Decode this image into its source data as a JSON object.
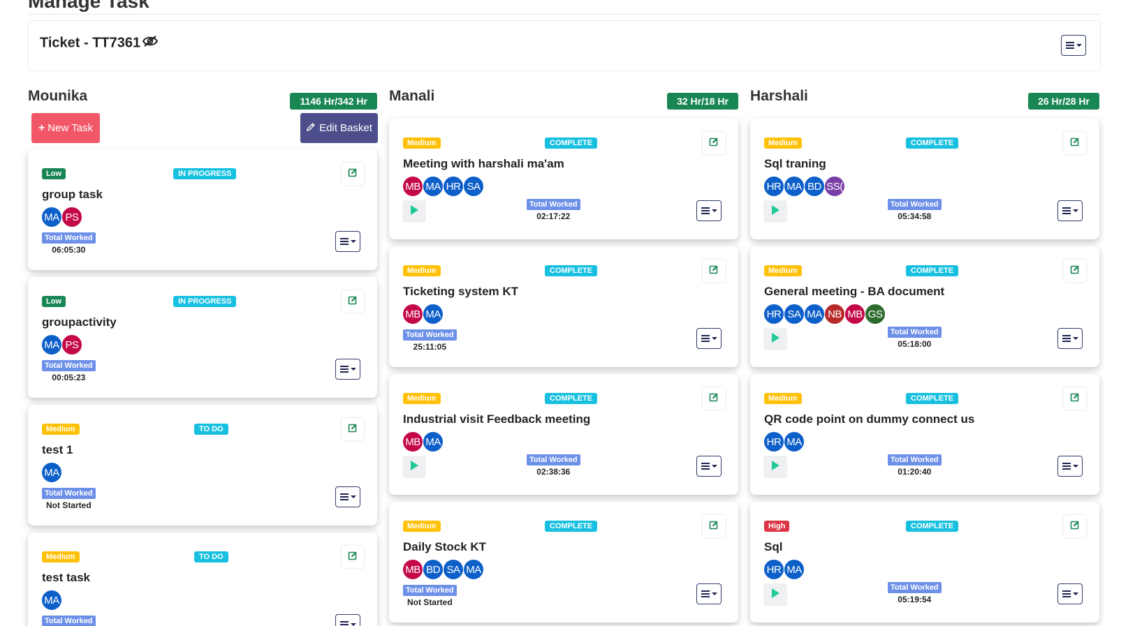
{
  "page": {
    "title": "Manage Task"
  },
  "ticket": {
    "title": "Ticket - TT7361",
    "eye_icon": "eye-slash-icon"
  },
  "colors": {
    "low": "#198754",
    "medium": "#ffc107",
    "high": "#dc3545",
    "status": "#17c0e0",
    "hours_badge": "#198754",
    "new_task": "#f25768",
    "edit_basket": "#4b4e8a",
    "total_worked": "#6c8fe8"
  },
  "columns": [
    {
      "name": "Mounika",
      "hours": "1146 Hr/342 Hr",
      "buttons": {
        "new_task": "New Task",
        "edit_basket": "Edit Basket"
      },
      "cards": [
        {
          "priority": "Low",
          "status": "IN PROGRESS",
          "title": "group task",
          "avatars": [
            "MA",
            "PS"
          ],
          "total_label": "Total Worked",
          "time": "06:05:30",
          "play": false
        },
        {
          "priority": "Low",
          "status": "IN PROGRESS",
          "title": "groupactivity",
          "avatars": [
            "MA",
            "PS"
          ],
          "total_label": "Total Worked",
          "time": "00:05:23",
          "play": false
        },
        {
          "priority": "Medium",
          "status": "TO DO",
          "title": "test 1",
          "avatars": [
            "MA"
          ],
          "total_label": "Total Worked",
          "time": "Not Started",
          "play": false
        },
        {
          "priority": "Medium",
          "status": "TO DO",
          "title": "test task",
          "avatars": [
            "MA"
          ],
          "total_label": "Total Worked",
          "time": "",
          "play": false
        }
      ]
    },
    {
      "name": "Manali",
      "hours": "32 Hr/18 Hr",
      "cards": [
        {
          "priority": "Medium",
          "status": "COMPLETE",
          "title": "Meeting with harshali ma'am",
          "avatars": [
            "MB",
            "MA",
            "HR",
            "SA"
          ],
          "total_label": "Total Worked",
          "time": "02:17:22",
          "play": true
        },
        {
          "priority": "Medium",
          "status": "COMPLETE",
          "title": "Ticketing system KT",
          "avatars": [
            "MB",
            "MA"
          ],
          "total_label": "Total Worked",
          "time": "25:11:05",
          "play": false
        },
        {
          "priority": "Medium",
          "status": "COMPLETE",
          "title": "Industrial visit Feedback meeting",
          "avatars": [
            "MB",
            "MA"
          ],
          "total_label": "Total Worked",
          "time": "02:38:36",
          "play": true
        },
        {
          "priority": "Medium",
          "status": "COMPLETE",
          "title": "Daily Stock KT",
          "avatars": [
            "MB",
            "BD",
            "SA",
            "MA"
          ],
          "total_label": "Total Worked",
          "time": "Not Started",
          "play": false
        }
      ]
    },
    {
      "name": "Harshali",
      "hours": "26 Hr/28 Hr",
      "cards": [
        {
          "priority": "Medium",
          "status": "COMPLETE",
          "title": "Sql traning",
          "avatars": [
            "HR",
            "MA",
            "BD",
            "SS("
          ],
          "total_label": "Total Worked",
          "time": "05:34:58",
          "play": true
        },
        {
          "priority": "Medium",
          "status": "COMPLETE",
          "title": "General meeting - BA document",
          "avatars": [
            "HR",
            "SA",
            "MA",
            "NB",
            "MB",
            "GS"
          ],
          "total_label": "Total Worked",
          "time": "05:18:00",
          "play": true
        },
        {
          "priority": "Medium",
          "status": "COMPLETE",
          "title": "QR code point on dummy connect us",
          "avatars": [
            "HR",
            "MA"
          ],
          "total_label": "Total Worked",
          "time": "01:20:40",
          "play": true
        },
        {
          "priority": "High",
          "status": "COMPLETE",
          "title": "Sql",
          "avatars": [
            "HR",
            "MA"
          ],
          "total_label": "Total Worked",
          "time": "05:19:54",
          "play": true
        }
      ]
    }
  ],
  "avatar_colors": {
    "MA": "#0d5fc9",
    "PS": "#c4084a",
    "MB": "#c4084a",
    "HR": "#0d5fc9",
    "SA": "#0d5fc9",
    "BD": "#0d5fc9",
    "SS(": "#7a3fa6",
    "NB": "#b82a2a",
    "GS": "#2e6b2e"
  }
}
